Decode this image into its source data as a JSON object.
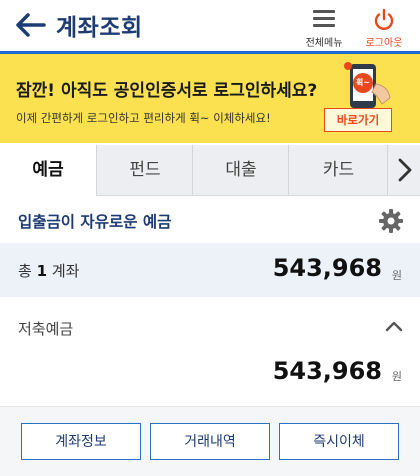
{
  "header": {
    "title": "계좌조회",
    "menu_label": "전체메뉴",
    "logout_label": "로그아웃"
  },
  "banner": {
    "title": "잠깐! 아직도 공인인증서로 로그인하세요?",
    "subtitle": "이제 간편하게 로그인하고 편리하게 휙~ 이체하세요!",
    "button_label": "바로가기",
    "image_badge": "휙~"
  },
  "tabs": [
    "예금",
    "펀드",
    "대출",
    "카드"
  ],
  "section": {
    "title": "입출금이 자유로운 예금"
  },
  "summary": {
    "prefix": "총",
    "count": "1",
    "suffix": "계좌",
    "amount": "543,968",
    "unit": "원"
  },
  "account": {
    "name": "저축예금",
    "amount": "543,968",
    "unit": "원"
  },
  "actions": [
    "계좌정보",
    "거래내역",
    "즉시이체"
  ],
  "colors": {
    "accent": "#1d6bd1",
    "brand_text": "#1e3c74",
    "banner_bg": "#fbe14f",
    "logout": "#e8481c"
  }
}
